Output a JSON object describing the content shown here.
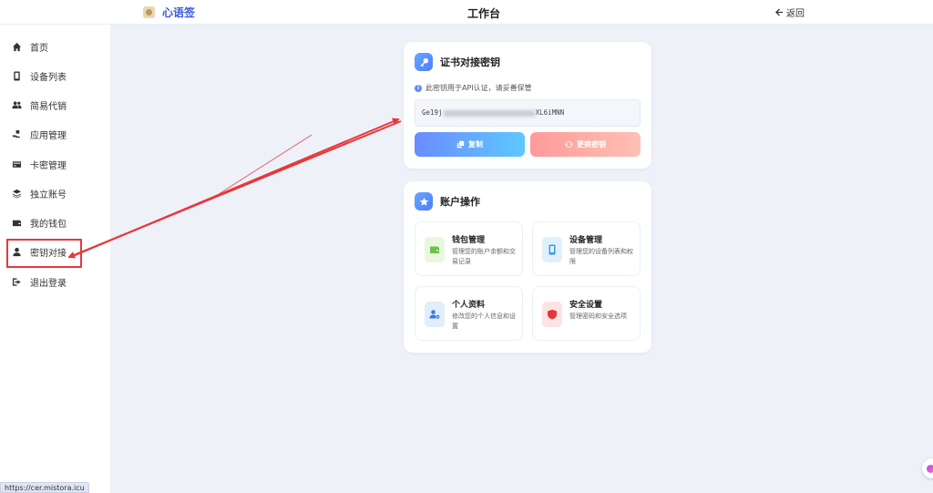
{
  "header": {
    "brand_name": "心语签",
    "title": "工作台",
    "back_label": "返回"
  },
  "sidebar": {
    "items": [
      {
        "label": "首页",
        "icon": "home-icon"
      },
      {
        "label": "设备列表",
        "icon": "phone-icon"
      },
      {
        "label": "简易代销",
        "icon": "users-icon"
      },
      {
        "label": "应用管理",
        "icon": "hand-icon"
      },
      {
        "label": "卡密管理",
        "icon": "card-icon"
      },
      {
        "label": "独立账号",
        "icon": "layers-icon"
      },
      {
        "label": "我的钱包",
        "icon": "wallet-icon"
      },
      {
        "label": "密钥对接",
        "icon": "user-icon"
      },
      {
        "label": "退出登录",
        "icon": "logout-icon"
      }
    ],
    "highlighted_item": "密钥对接"
  },
  "key_card": {
    "title": "证书对接密钥",
    "hint": "此密钥用于API认证，请妥善保管",
    "key_prefix": "Ge19j",
    "key_suffix": "XL6iMNN",
    "copy_label": "复制",
    "change_label": "更换密钥"
  },
  "account_card": {
    "title": "账户操作",
    "tiles": [
      {
        "title": "钱包管理",
        "desc": "管理您的账户余额和交易记录",
        "icon": "wallet-icon",
        "color": "#6cc04a"
      },
      {
        "title": "设备管理",
        "desc": "管理您的设备列表和权限",
        "icon": "phone-icon",
        "color": "#3a9bd8"
      },
      {
        "title": "个人资料",
        "desc": "修改您的个人信息和设置",
        "icon": "user-gear-icon",
        "color": "#3a7bd8"
      },
      {
        "title": "安全设置",
        "desc": "管理密码和安全选项",
        "icon": "shield-icon",
        "color": "#e5383b"
      }
    ]
  },
  "status_bar": {
    "url": "https://cer.mistora.icu"
  },
  "colors": {
    "accent": "#3b5bdb",
    "annotation_red": "#e5383b"
  }
}
